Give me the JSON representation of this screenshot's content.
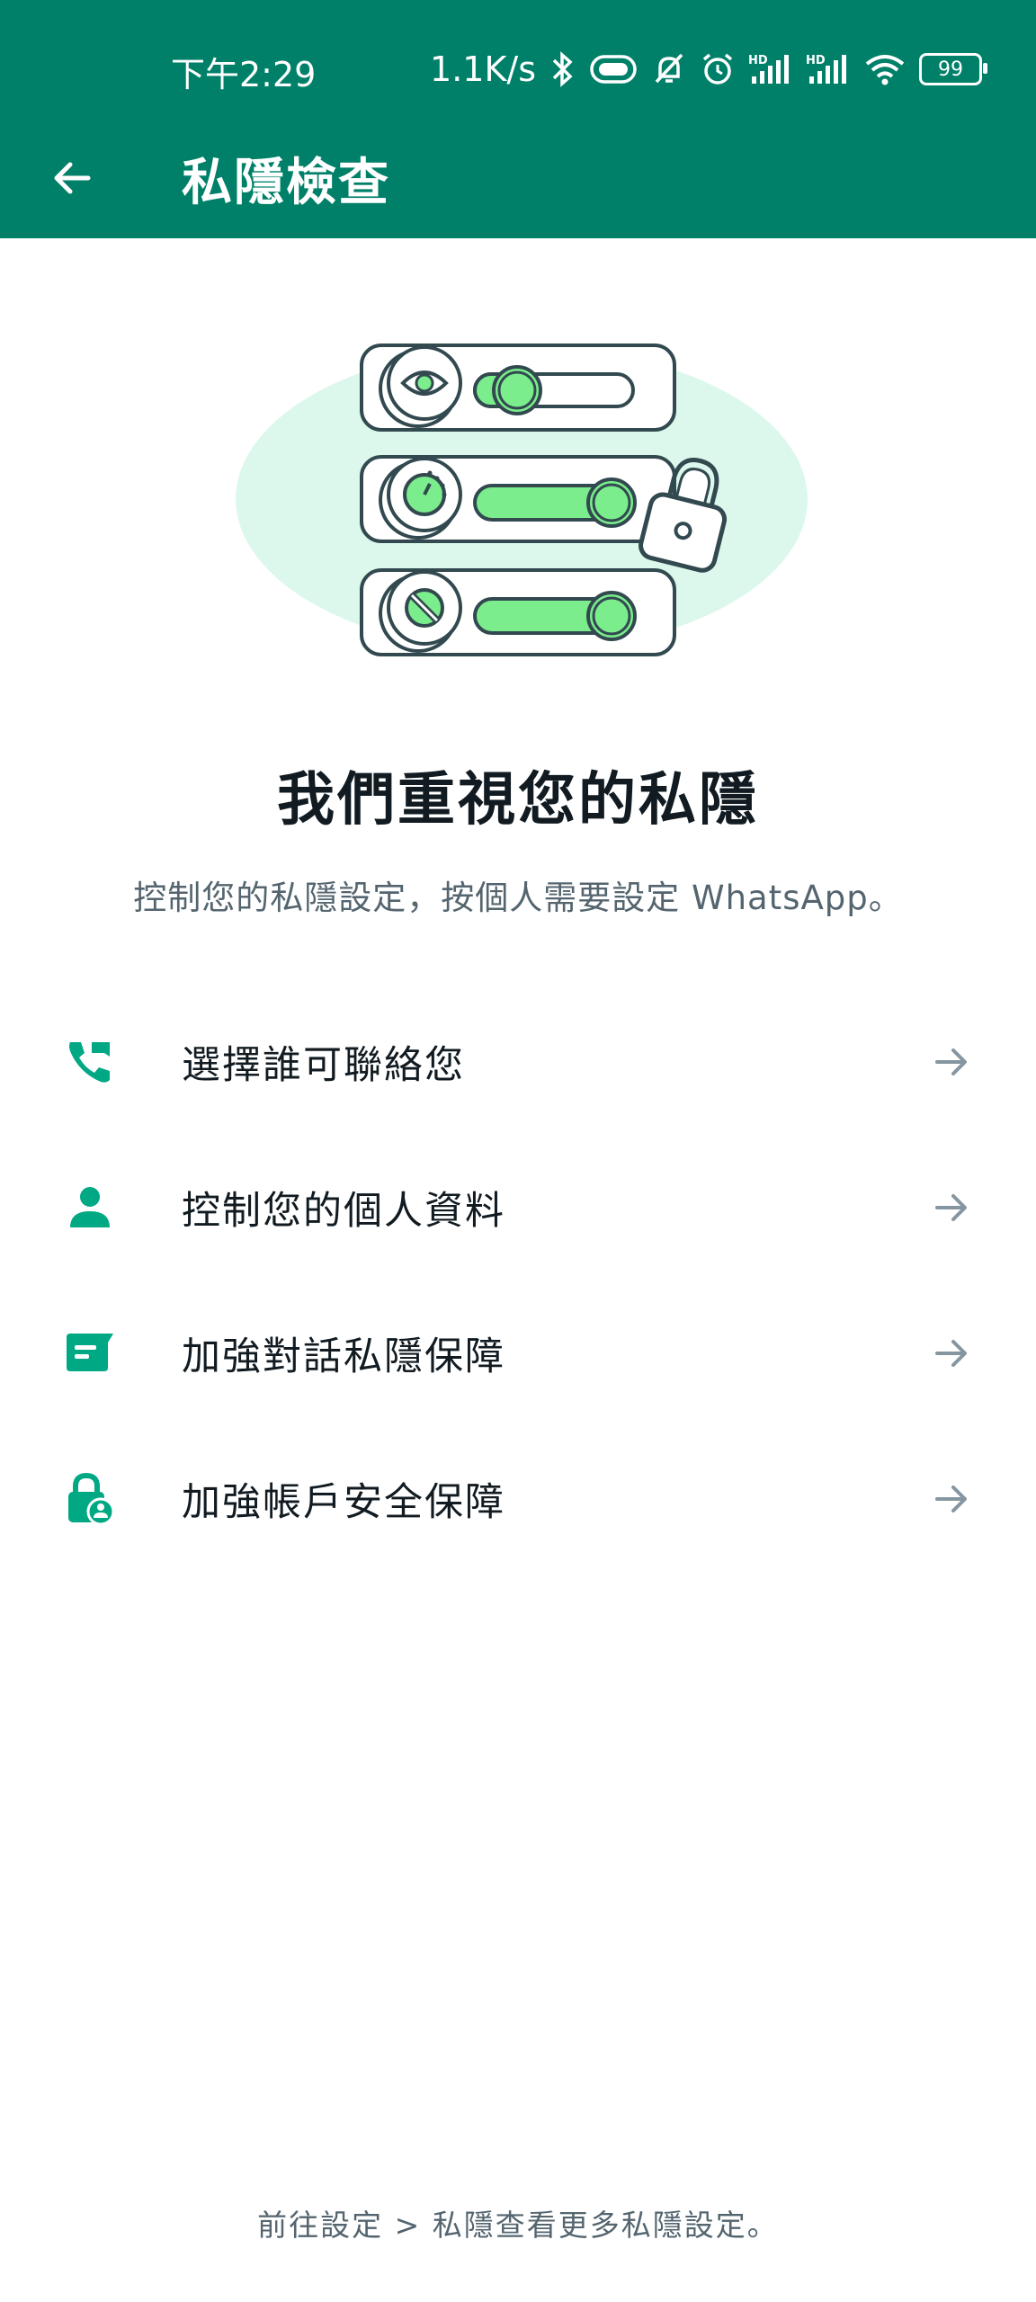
{
  "status_bar": {
    "time": "下午2:29",
    "net_speed": "1.1K/s",
    "battery": "99",
    "icons": [
      "bluetooth-icon",
      "vibrate-icon",
      "mute-icon",
      "alarm-icon",
      "hd-signal-icon",
      "hd-signal-icon",
      "wifi-icon",
      "battery-icon"
    ]
  },
  "app_bar": {
    "title": "私隱檢查",
    "back_icon": "arrow-left-icon",
    "color": "#008069"
  },
  "hero": {
    "headline": "我們重視您的私隱",
    "subtext": "控制您的私隱設定，按個人需要設定 WhatsApp。"
  },
  "menu": [
    {
      "label": "選擇誰可聯絡您",
      "icon": "phone-contact-icon"
    },
    {
      "label": "控制您的個人資料",
      "icon": "person-icon"
    },
    {
      "label": "加強對話私隱保障",
      "icon": "chat-icon"
    },
    {
      "label": "加強帳戶安全保障",
      "icon": "account-lock-icon"
    }
  ],
  "footer": {
    "note": "前往設定 > 私隱查看更多私隱設定。"
  },
  "colors": {
    "accent": "#008069",
    "icon_green": "#00a884",
    "illustration_green": "#7bed8d",
    "illustration_bg": "#d9fdd3"
  }
}
